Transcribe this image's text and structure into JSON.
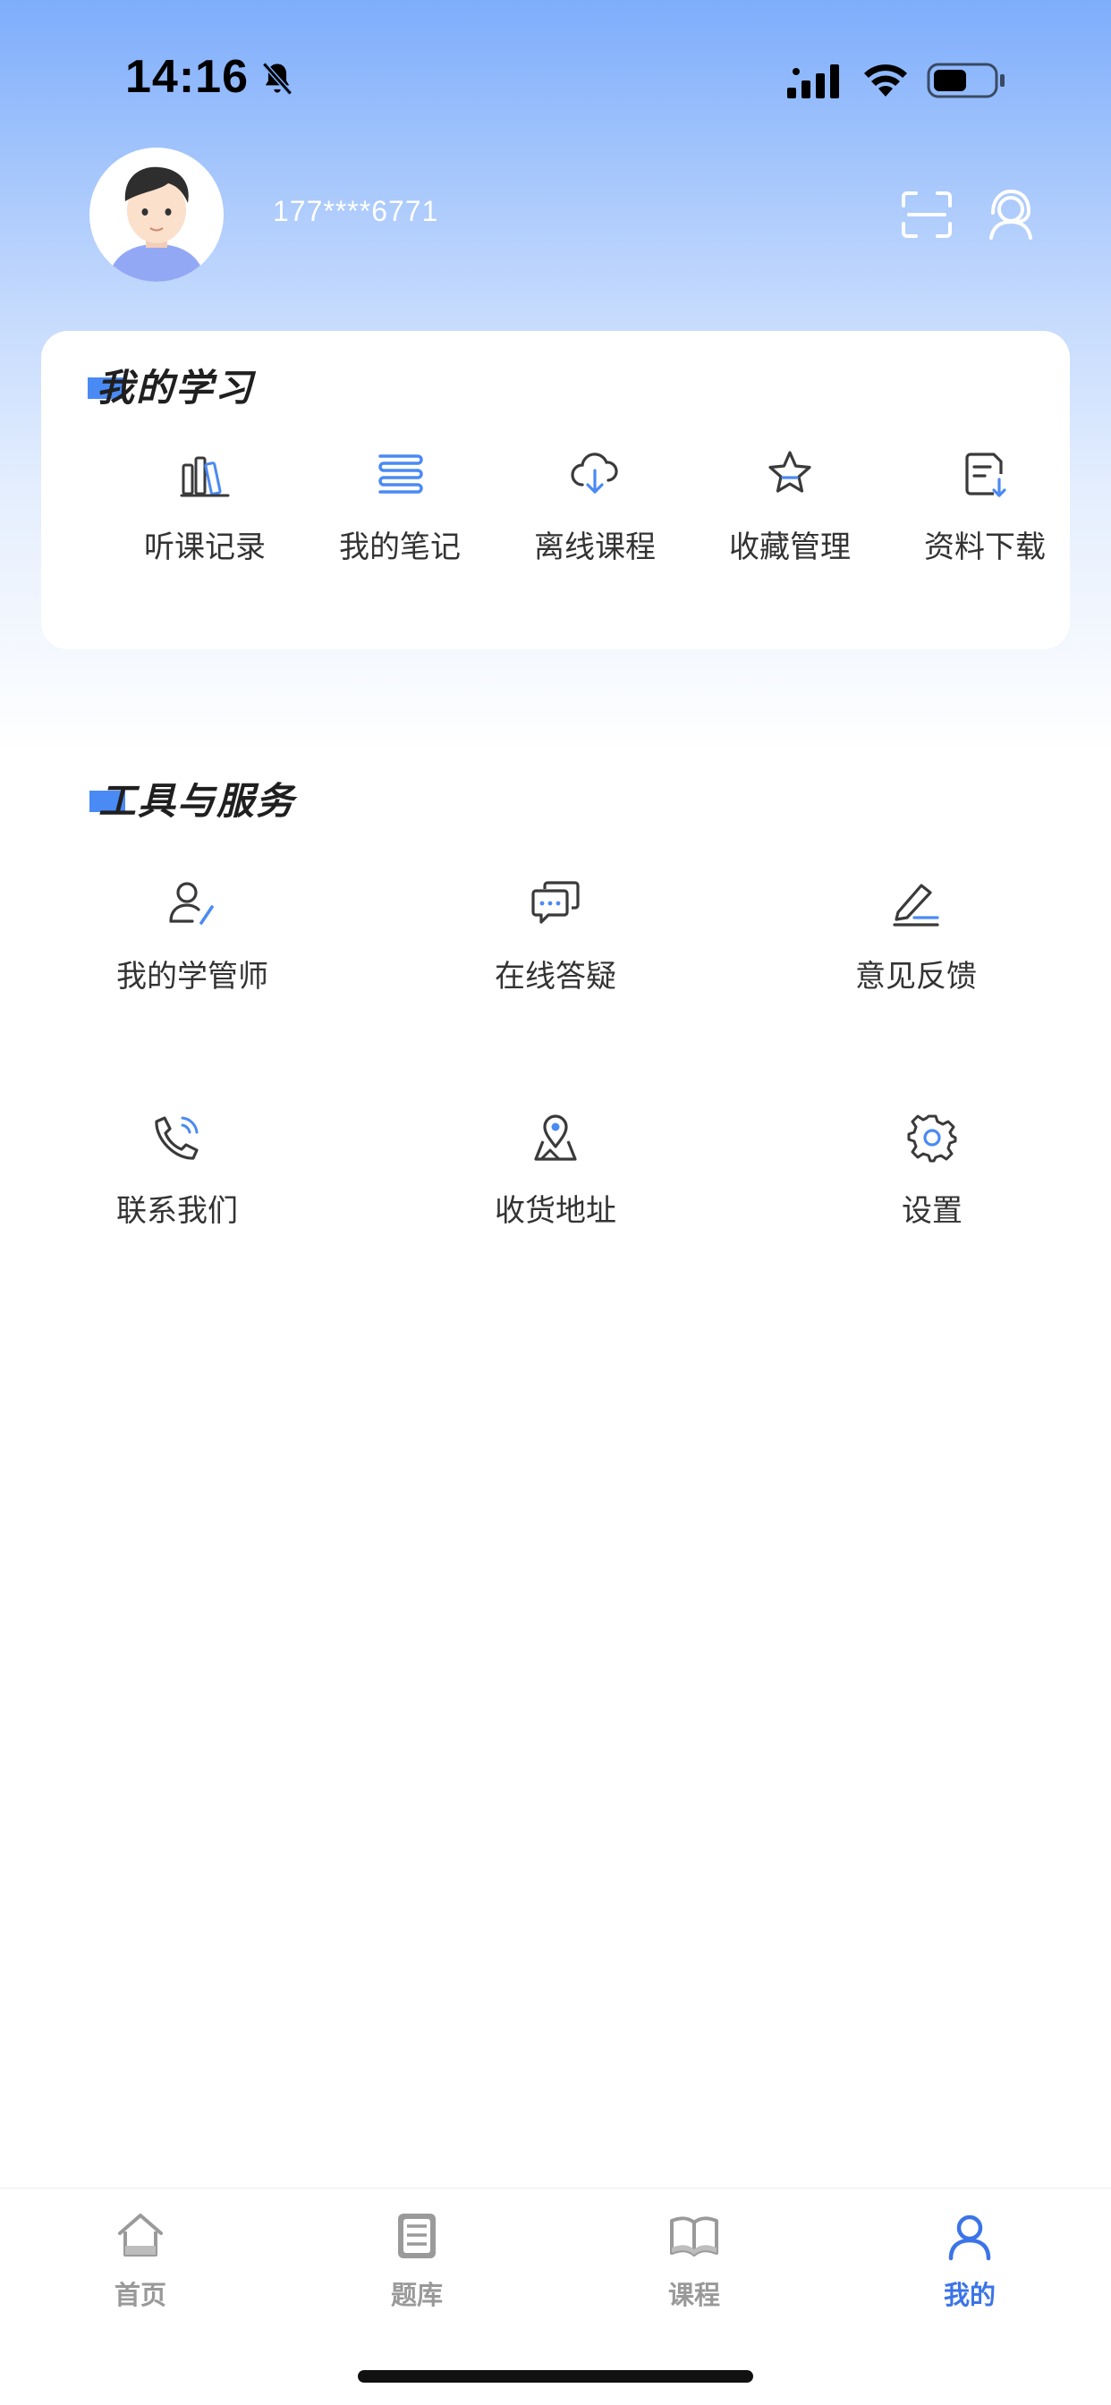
{
  "status_bar": {
    "time": "14:16"
  },
  "profile": {
    "phone": "177****6771"
  },
  "my_study": {
    "title": "我的学习",
    "items": [
      {
        "label": "听课记录",
        "icon": "books-icon"
      },
      {
        "label": "我的笔记",
        "icon": "notebook-icon"
      },
      {
        "label": "离线课程",
        "icon": "cloud-download-icon"
      },
      {
        "label": "收藏管理",
        "icon": "star-icon"
      },
      {
        "label": "资料下载",
        "icon": "document-download-icon"
      }
    ]
  },
  "tools": {
    "title": "工具与服务",
    "items": [
      {
        "label": "我的学管师",
        "icon": "user-edit-icon"
      },
      {
        "label": "在线答疑",
        "icon": "chat-bubbles-icon"
      },
      {
        "label": "意见反馈",
        "icon": "edit-pen-icon"
      },
      {
        "label": "联系我们",
        "icon": "phone-call-icon"
      },
      {
        "label": "收货地址",
        "icon": "map-pin-icon"
      },
      {
        "label": "设置",
        "icon": "gear-icon"
      }
    ]
  },
  "tabbar": {
    "tabs": [
      {
        "label": "首页",
        "icon": "home-icon"
      },
      {
        "label": "题库",
        "icon": "question-bank-icon"
      },
      {
        "label": "课程",
        "icon": "book-open-icon"
      },
      {
        "label": "我的",
        "icon": "user-icon",
        "active": true
      }
    ]
  },
  "colors": {
    "accent": "#3c74e8",
    "header_top": "#7eadfb"
  }
}
